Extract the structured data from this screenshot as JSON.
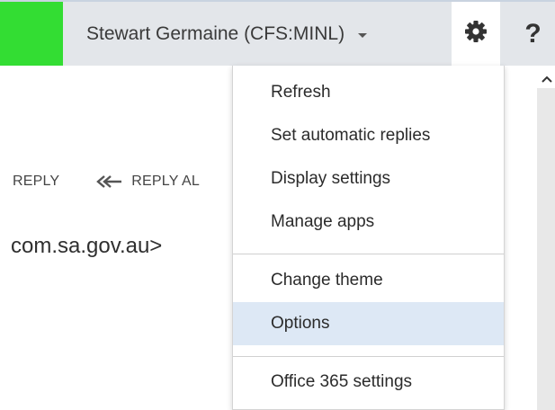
{
  "header": {
    "user_label": "Stewart Germaine (CFS:MINL)",
    "user_chevron": "chevron-down-icon",
    "settings_icon": "gear-icon",
    "help_label": "?",
    "accent_color": "#33dd33"
  },
  "reading_pane": {
    "reply_label": "REPLY",
    "reply_all_label": "REPLY AL",
    "email_fragment": "com.sa.gov.au>"
  },
  "settings_menu": {
    "items": [
      {
        "label": "Refresh"
      },
      {
        "label": "Set automatic replies"
      },
      {
        "label": "Display settings"
      },
      {
        "label": "Manage apps"
      },
      {
        "label": "Change theme"
      },
      {
        "label": "Options",
        "highlighted": true
      },
      {
        "label": "Office 365 settings"
      }
    ]
  }
}
